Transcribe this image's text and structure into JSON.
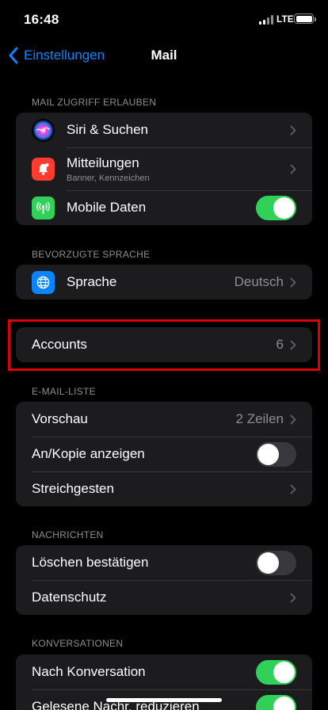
{
  "status": {
    "time": "16:48",
    "network": "LTE"
  },
  "nav": {
    "back_label": "Einstellungen",
    "title": "Mail"
  },
  "sections": {
    "access": {
      "header": "MAIL ZUGRIFF ERLAUBEN",
      "siri": {
        "label": "Siri & Suchen"
      },
      "notifications": {
        "label": "Mitteilungen",
        "sub": "Banner, Kennzeichen"
      },
      "mobile_data": {
        "label": "Mobile Daten",
        "on": true
      }
    },
    "language": {
      "header": "BEVORZUGTE SPRACHE",
      "language": {
        "label": "Sprache",
        "value": "Deutsch"
      }
    },
    "accounts": {
      "label": "Accounts",
      "value": "6"
    },
    "mail_list": {
      "header": "E-MAIL-LISTE",
      "preview": {
        "label": "Vorschau",
        "value": "2 Zeilen"
      },
      "cc": {
        "label": "An/Kopie anzeigen",
        "on": false
      },
      "swipe": {
        "label": "Streichgesten"
      }
    },
    "messages": {
      "header": "NACHRICHTEN",
      "confirm_delete": {
        "label": "Löschen bestätigen",
        "on": false
      },
      "privacy": {
        "label": "Datenschutz"
      }
    },
    "conversations": {
      "header": "KONVERSATIONEN",
      "by_thread": {
        "label": "Nach Konversation",
        "on": true
      },
      "collapse_read": {
        "label": "Gelesene Nachr. reduzieren",
        "on": true
      }
    }
  },
  "colors": {
    "accent": "#0a84ff",
    "toggle_on": "#30d158",
    "highlight": "#e00000",
    "notifications_icon": "#ff3b30",
    "mobile_data_icon": "#30d158",
    "language_icon": "#0a84ff"
  },
  "icons": {
    "back": "chevron-left-icon",
    "siri": "siri-icon",
    "notifications": "bell-icon",
    "mobile_data": "antenna-icon",
    "language": "globe-icon",
    "row_chevron": "chevron-right-icon"
  }
}
